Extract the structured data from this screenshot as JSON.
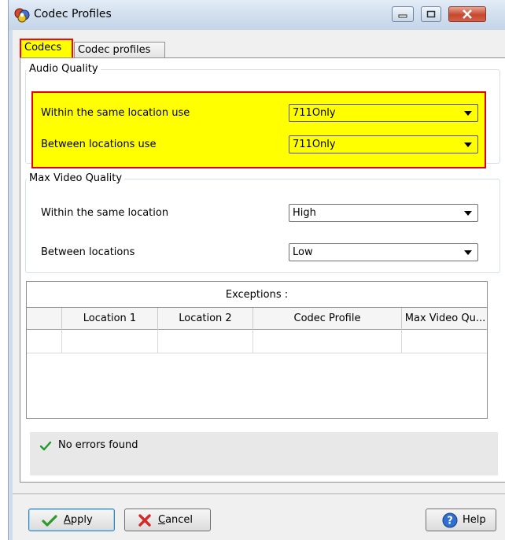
{
  "window": {
    "title": "Codec Profiles",
    "accent_highlight": "#ffff00",
    "highlight_border": "#e00000"
  },
  "tabs": [
    {
      "label": "Codecs",
      "active": true
    },
    {
      "label": "Codec profiles",
      "active": false
    }
  ],
  "audio_quality": {
    "group_label": "Audio Quality",
    "rows": [
      {
        "label": "Within the same location use",
        "value": "711Only"
      },
      {
        "label": "Between locations use",
        "value": "711Only"
      }
    ]
  },
  "video_quality": {
    "group_label": "Max Video Quality",
    "rows": [
      {
        "label": "Within the same location",
        "value": "High"
      },
      {
        "label": "Between locations",
        "value": "Low"
      }
    ]
  },
  "exceptions": {
    "title": "Exceptions :",
    "columns": [
      "Location 1",
      "Location 2",
      "Codec Profile",
      "Max Video Qu..."
    ]
  },
  "status": {
    "icon": "checkmark-icon",
    "text": "No errors found"
  },
  "buttons": {
    "apply": "Apply",
    "cancel": "Cancel",
    "help": "Help"
  }
}
